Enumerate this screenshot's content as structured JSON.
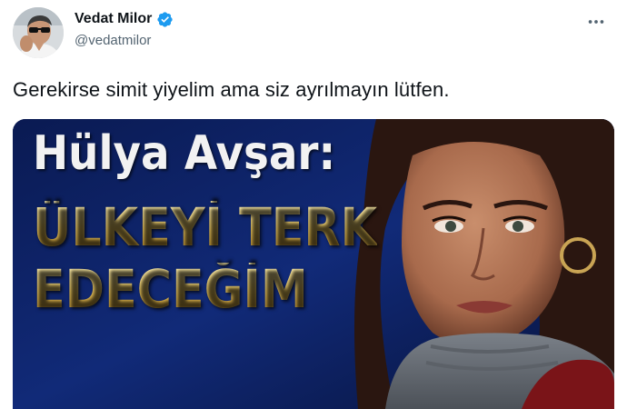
{
  "tweet": {
    "author": {
      "display_name": "Vedat Milor",
      "handle": "@vedatmilor",
      "verified": true,
      "verified_icon": "verified-badge-icon"
    },
    "more_icon": "more-horizontal-icon",
    "text": "Gerekirse simit yiyelim ama siz ayrılmayın lütfen.",
    "media": {
      "headline_name": "Hülya Avşar:",
      "headline_line1": "ÜLKEYİ TERK",
      "headline_line2": "EDECEĞİM",
      "colors": {
        "background": "#0b1a4a",
        "headline_gold": "#e6c25a",
        "headline_white": "#f2f2f2"
      }
    },
    "colors": {
      "verified_blue": "#1d9bf0",
      "text": "#0f1419",
      "secondary": "#536471"
    }
  }
}
